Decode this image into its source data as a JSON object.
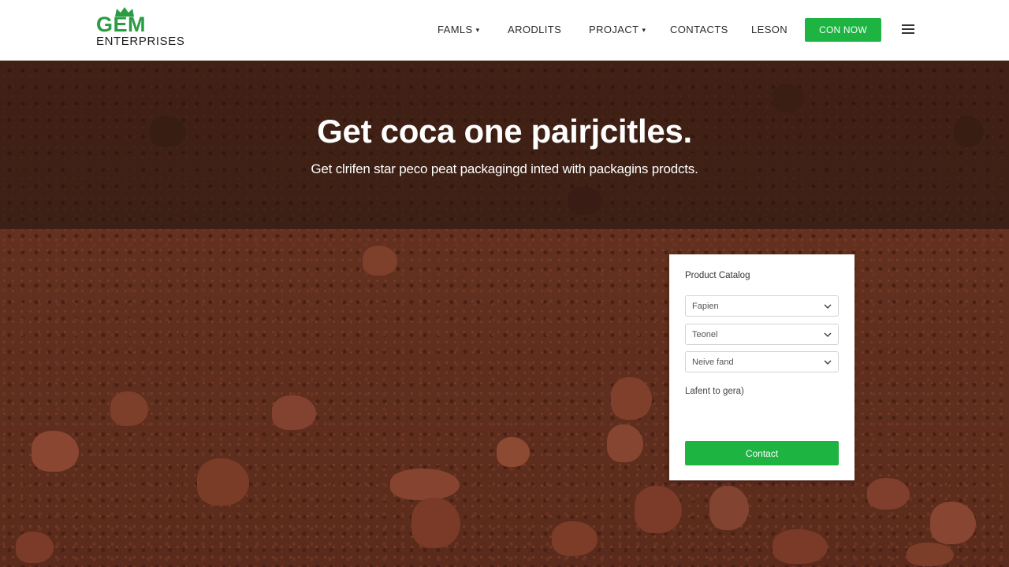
{
  "brand": {
    "name": "GEM",
    "subtitle": "ENTERPRISES",
    "crown_icon": "crown-icon",
    "color": "#2a9c41"
  },
  "nav": {
    "items": [
      {
        "label": "FAMLS",
        "has_dropdown": true
      },
      {
        "label": "ARODLITS",
        "has_dropdown": false
      },
      {
        "label": "PROJACT",
        "has_dropdown": true
      },
      {
        "label": "CONTACTS",
        "has_dropdown": false
      },
      {
        "label": "LESON",
        "has_dropdown": false
      }
    ],
    "cta_label": "CON NOW",
    "menu_icon": "hamburger-menu-icon"
  },
  "hero": {
    "title": "Get coca one pairjcitles.",
    "subtitle": "Get clrifen star peco peat packagingd inted with packagins prodcts."
  },
  "catalog": {
    "title": "Product Catalog",
    "selects": [
      {
        "value": "Fapien",
        "icon": "chevron-down-icon"
      },
      {
        "value": "Teonel",
        "icon": "chevron-down-icon"
      },
      {
        "value": "Neive fand",
        "icon": "chevron-down-icon"
      }
    ],
    "note": "Lafent to gera)",
    "button_label": "Contact"
  },
  "colors": {
    "accent": "#1db442",
    "soil": "#62301f",
    "header_bg": "#ffffff"
  }
}
